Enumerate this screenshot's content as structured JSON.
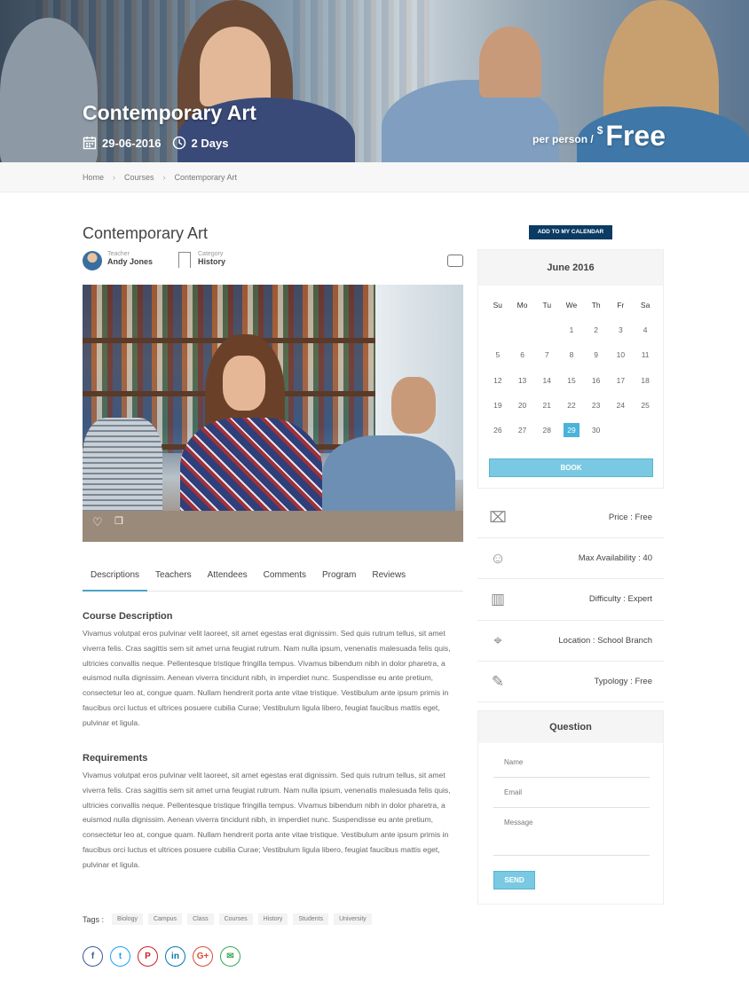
{
  "hero": {
    "title": "Contemporary Art",
    "date": "29-06-2016",
    "duration": "2 Days",
    "per_person": "per person /",
    "currency": "$",
    "price": "Free"
  },
  "breadcrumb": [
    "Home",
    "Courses",
    "Contemporary Art"
  ],
  "course": {
    "title": "Contemporary Art",
    "teacher_label": "Teacher",
    "teacher": "Andy Jones",
    "category_label": "Category",
    "category": "History"
  },
  "tabs": [
    "Descriptions",
    "Teachers",
    "Attendees",
    "Comments",
    "Program",
    "Reviews"
  ],
  "description": {
    "heading": "Course Description",
    "text": "Vivamus volutpat eros pulvinar velit laoreet, sit amet egestas erat dignissim. Sed quis rutrum tellus, sit amet viverra felis. Cras sagittis sem sit amet urna feugiat rutrum. Nam nulla ipsum, venenatis malesuada felis quis, ultricies convallis neque. Pellentesque tristique fringilla tempus. Vivamus bibendum nibh in dolor pharetra, a euismod nulla dignissim. Aenean viverra tincidunt nibh, in imperdiet nunc. Suspendisse eu ante pretium, consectetur leo at, congue quam. Nullam hendrerit porta ante vitae tristique. Vestibulum ante ipsum primis in faucibus orci luctus et ultrices posuere cubilia Curae; Vestibulum ligula libero, feugiat faucibus mattis eget, pulvinar et ligula."
  },
  "requirements": {
    "heading": "Requirements",
    "text": "Vivamus volutpat eros pulvinar velit laoreet, sit amet egestas erat dignissim. Sed quis rutrum tellus, sit amet viverra felis. Cras sagittis sem sit amet urna feugiat rutrum. Nam nulla ipsum, venenatis malesuada felis quis, ultricies convallis neque. Pellentesque tristique fringilla tempus. Vivamus bibendum nibh in dolor pharetra, a euismod nulla dignissim. Aenean viverra tincidunt nibh, in imperdiet nunc. Suspendisse eu ante pretium, consectetur leo at, congue quam. Nullam hendrerit porta ante vitae tristique. Vestibulum ante ipsum primis in faucibus orci luctus et ultrices posuere cubilia Curae; Vestibulum ligula libero, feugiat faucibus mattis eget, pulvinar et ligula."
  },
  "tags": {
    "label": "Tags :",
    "items": [
      "Biology",
      "Campus",
      "Class",
      "Courses",
      "History",
      "Students",
      "University"
    ]
  },
  "social": [
    {
      "name": "facebook-icon",
      "glyph": "f",
      "color": "#3b5998"
    },
    {
      "name": "twitter-icon",
      "glyph": "t",
      "color": "#1da1f2"
    },
    {
      "name": "pinterest-icon",
      "glyph": "P",
      "color": "#cb2027"
    },
    {
      "name": "linkedin-icon",
      "glyph": "in",
      "color": "#0077b5"
    },
    {
      "name": "googleplus-icon",
      "glyph": "G+",
      "color": "#dd4b39"
    },
    {
      "name": "email-icon",
      "glyph": "✉",
      "color": "#3aa757"
    }
  ],
  "calendar": {
    "add_button": "ADD TO MY CALENDAR",
    "month": "June 2016",
    "weekdays": [
      "Su",
      "Mo",
      "Tu",
      "We",
      "Th",
      "Fr",
      "Sa"
    ],
    "weeks": [
      [
        "",
        "",
        "",
        "1",
        "2",
        "3",
        "4"
      ],
      [
        "5",
        "6",
        "7",
        "8",
        "9",
        "10",
        "11"
      ],
      [
        "12",
        "13",
        "14",
        "15",
        "16",
        "17",
        "18"
      ],
      [
        "19",
        "20",
        "21",
        "22",
        "23",
        "24",
        "25"
      ],
      [
        "26",
        "27",
        "28",
        "29",
        "30",
        "",
        ""
      ]
    ],
    "selected": "29",
    "book_button": "BOOK"
  },
  "info": [
    {
      "icon": "price-tag-icon",
      "glyph": "⌧",
      "text": "Price : Free"
    },
    {
      "icon": "users-icon",
      "glyph": "☺",
      "text": "Max Availability : 40"
    },
    {
      "icon": "bar-chart-icon",
      "glyph": "▥",
      "text": "Difficulty : Expert"
    },
    {
      "icon": "location-pin-icon",
      "glyph": "⌖",
      "text": "Location : School Branch"
    },
    {
      "icon": "tag-icon",
      "glyph": "✎",
      "text": "Typology : Free"
    }
  ],
  "question": {
    "title": "Question",
    "name_placeholder": "Name",
    "email_placeholder": "Email",
    "message_placeholder": "Message",
    "send_button": "SEND"
  },
  "colors": {
    "accent": "#4ab3d9",
    "navy": "#0b3b63",
    "button": "#7ac9e2"
  }
}
